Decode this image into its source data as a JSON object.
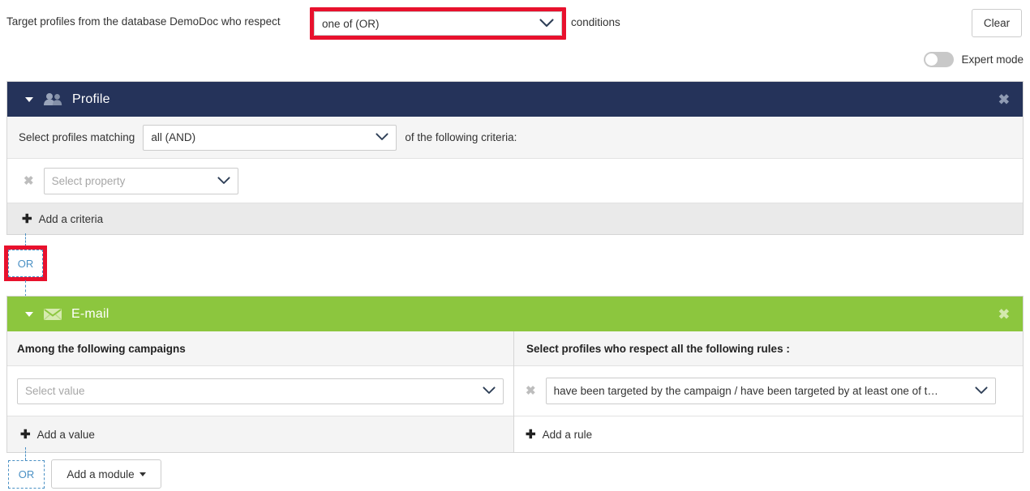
{
  "top": {
    "sentence_before": "Target profiles from the database DemoDoc who respect",
    "condition_select_value": "one of (OR)",
    "sentence_after": "conditions",
    "clear_label": "Clear",
    "expert_mode_label": "Expert mode",
    "expert_mode_on": false,
    "highlight_color": "#e8112d"
  },
  "profile_module": {
    "title": "Profile",
    "icon": "people-icon",
    "header_color": "#25335a",
    "close_label": "✖",
    "matching_label": "Select profiles matching",
    "matching_value": "all (AND)",
    "matching_suffix": "of the following criteria:",
    "property_placeholder": "Select property",
    "remove_label": "✖",
    "add_criteria_label": "Add a criteria",
    "plus_glyph": "✚"
  },
  "or_connector_top": {
    "label": "OR",
    "highlighted": true,
    "border_color": "#4a90c4"
  },
  "email_module": {
    "title": "E-mail",
    "icon": "envelope-icon",
    "header_color": "#8cc63e",
    "close_label": "✖",
    "left": {
      "heading": "Among the following campaigns",
      "value_placeholder": "Select value",
      "add_label": "Add a value",
      "plus_glyph": "✚"
    },
    "right": {
      "heading": "Select profiles who respect all the following rules :",
      "remove_label": "✖",
      "rule_value": "have been targeted by the campaign / have been targeted by at least one of t…",
      "add_label": "Add a rule",
      "plus_glyph": "✚"
    }
  },
  "bottom": {
    "or_label": "OR",
    "add_module_label": "Add a module"
  }
}
